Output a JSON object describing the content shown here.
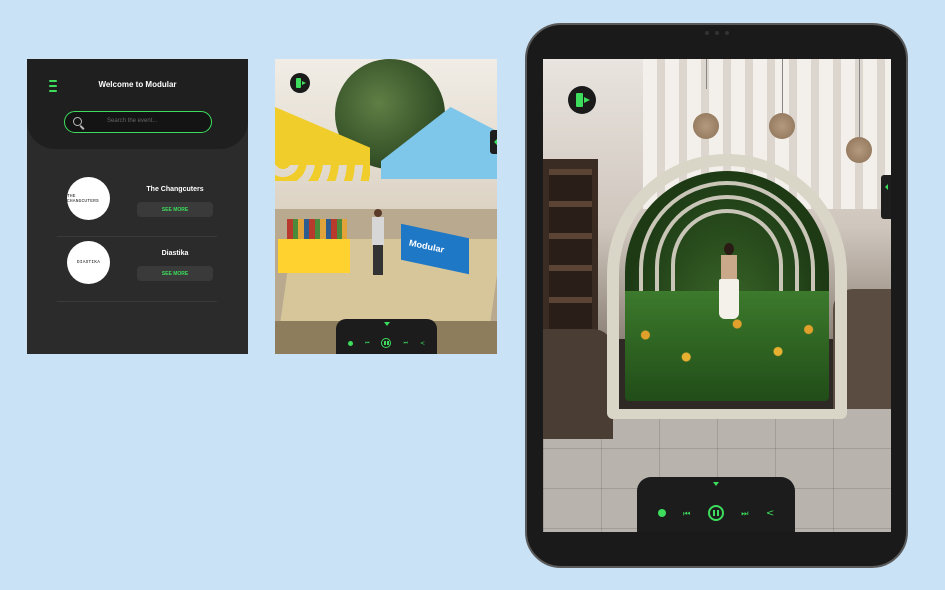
{
  "list_app": {
    "title": "Welcome to Modular",
    "search_placeholder": "Search the event...",
    "items": [
      {
        "name": "The Changcuters",
        "logo_text": "THE CHANGCUTERS",
        "action": "SEE MORE"
      },
      {
        "name": "Diastika",
        "logo_text": "DIASTIKA",
        "action": "SEE MORE"
      }
    ]
  },
  "market_scene": {
    "booth_sign": "Modular"
  },
  "colors": {
    "accent": "#3ddc5c",
    "background": "#c9e2f5",
    "panel": "#2b2b2b"
  },
  "icons": [
    "menu-icon",
    "search-icon",
    "exit-icon",
    "chevron-down-icon",
    "previous-icon",
    "pause-icon",
    "next-icon",
    "share-icon",
    "record-icon",
    "chevron-left-icon"
  ]
}
